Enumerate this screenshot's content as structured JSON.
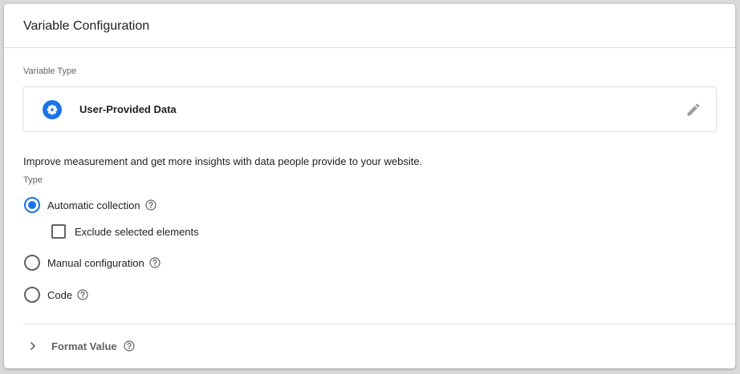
{
  "card": {
    "title": "Variable Configuration"
  },
  "variable_type": {
    "section_label": "Variable Type",
    "name": "User-Provided Data",
    "icon": "gear-icon",
    "edit_icon": "pencil-icon"
  },
  "description": "Improve measurement and get more insights with data people provide to your website.",
  "type_section": {
    "label": "Type",
    "options": [
      {
        "label": "Automatic collection",
        "selected": true,
        "help": true
      },
      {
        "label": "Manual configuration",
        "selected": false,
        "help": true
      },
      {
        "label": "Code",
        "selected": false,
        "help": true
      }
    ],
    "exclude_checkbox": {
      "label": "Exclude selected elements",
      "checked": false
    }
  },
  "format_value": {
    "label": "Format Value",
    "expanded": false
  },
  "colors": {
    "accent": "#1a73e8",
    "text": "#202124",
    "muted": "#5f6368",
    "border": "#dadce0"
  }
}
